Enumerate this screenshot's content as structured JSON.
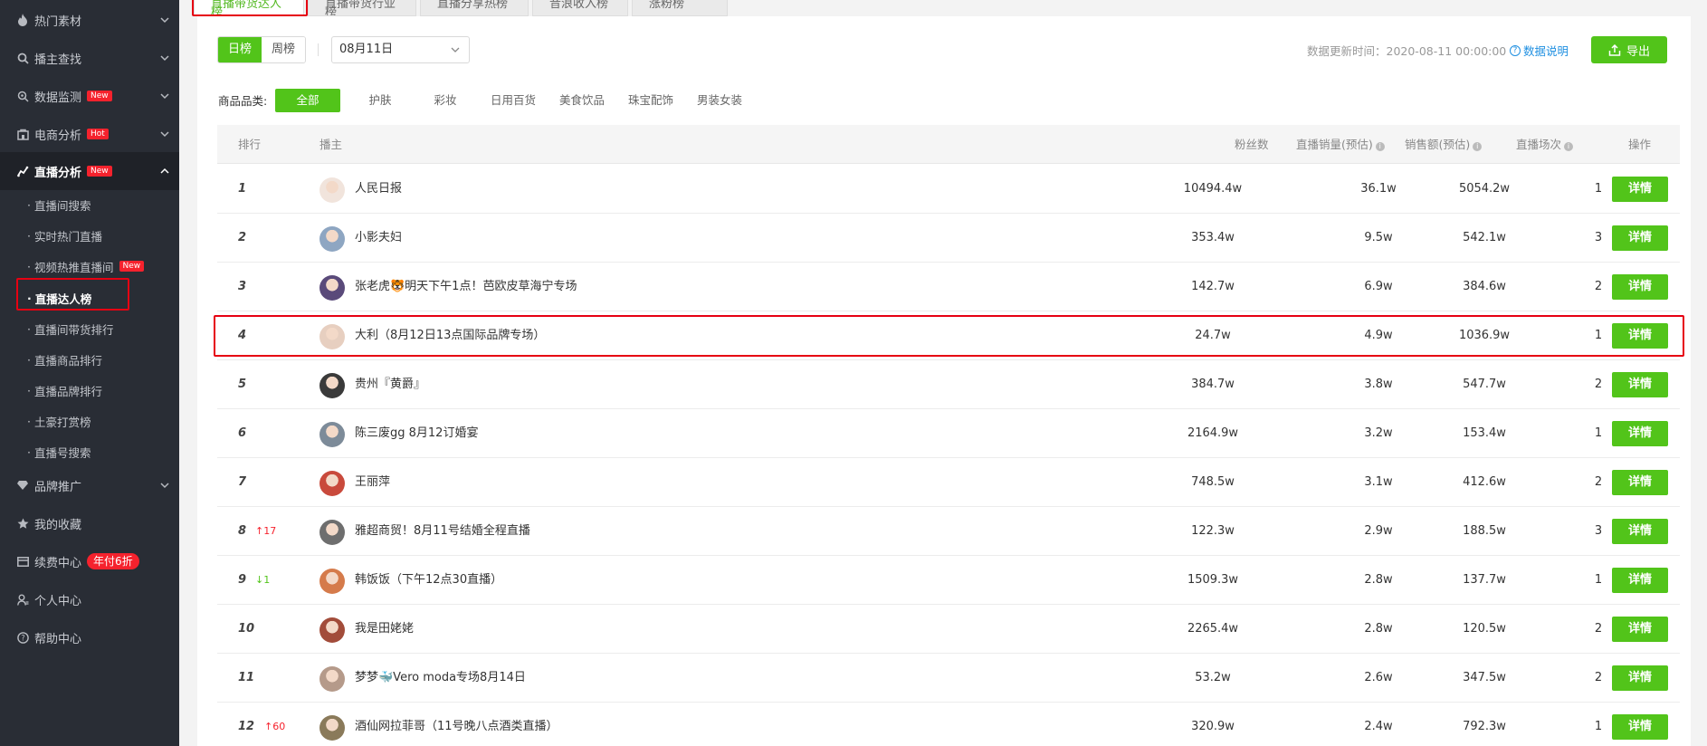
{
  "sidebar": {
    "items": [
      {
        "label": "热门素材",
        "icon": "fire-icon"
      },
      {
        "label": "播主查找",
        "icon": "search-icon"
      },
      {
        "label": "数据监测",
        "icon": "monitor-icon",
        "badge": "New"
      },
      {
        "label": "电商分析",
        "icon": "shop-icon",
        "badge": "Hot"
      },
      {
        "label": "直播分析",
        "icon": "live-chart-icon",
        "badge": "New"
      }
    ],
    "sub_items": [
      {
        "label": "直播间搜索"
      },
      {
        "label": "实时热门直播"
      },
      {
        "label": "视频热推直播间",
        "badge": "New"
      },
      {
        "label": "直播达人榜"
      },
      {
        "label": "直播间带货排行"
      },
      {
        "label": "直播商品排行"
      },
      {
        "label": "直播品牌排行"
      },
      {
        "label": "土豪打赏榜"
      },
      {
        "label": "直播号搜索"
      }
    ],
    "bottom_items": [
      {
        "label": "品牌推广",
        "icon": "diamond-icon"
      },
      {
        "label": "我的收藏",
        "icon": "star-icon"
      },
      {
        "label": "续费中心",
        "icon": "card-icon",
        "badge": "年付6折"
      },
      {
        "label": "个人中心",
        "icon": "user-icon"
      },
      {
        "label": "帮助中心",
        "icon": "help-icon"
      }
    ]
  },
  "tabs": [
    "直播带货达人榜",
    "直播带货行业榜",
    "直播分享热榜",
    "音浪收入榜",
    "涨粉榜"
  ],
  "toolbar": {
    "period_tabs": [
      "日榜",
      "周榜"
    ],
    "date": "08月11日",
    "update_label": "数据更新时间：2020-08-11 00:00:00",
    "help_label": "数据说明",
    "export_label": "导出"
  },
  "categories": {
    "label": "商品品类:",
    "items": [
      "全部",
      "护肤",
      "彩妆",
      "日用百货",
      "美食饮品",
      "珠宝配饰",
      "男装女装"
    ]
  },
  "table": {
    "headers": {
      "rank": "排行",
      "anchor": "播主",
      "fans": "粉丝数",
      "sales": "直播销量(预估)",
      "gmv": "销售额(预估)",
      "sessions": "直播场次",
      "action": "操作"
    },
    "detail_label": "详情",
    "rows": [
      {
        "rank": "1",
        "delta": "",
        "name": "人民日报",
        "fans": "10494.4w",
        "sales": "36.1w",
        "gmv": "5054.2w",
        "sessions": "1"
      },
      {
        "rank": "2",
        "delta": "",
        "name": "小影夫妇",
        "fans": "353.4w",
        "sales": "9.5w",
        "gmv": "542.1w",
        "sessions": "3"
      },
      {
        "rank": "3",
        "delta": "",
        "name": "张老虎🐯明天下午1点！芭欧皮草海宁专场",
        "fans": "142.7w",
        "sales": "6.9w",
        "gmv": "384.6w",
        "sessions": "2"
      },
      {
        "rank": "4",
        "delta": "",
        "name": "大利（8月12日13点国际品牌专场）",
        "fans": "24.7w",
        "sales": "4.9w",
        "gmv": "1036.9w",
        "sessions": "1"
      },
      {
        "rank": "5",
        "delta": "",
        "name": "贵州『黄爵』",
        "fans": "384.7w",
        "sales": "3.8w",
        "gmv": "547.7w",
        "sessions": "2"
      },
      {
        "rank": "6",
        "delta": "",
        "name": "陈三废gg 8月12订婚宴",
        "fans": "2164.9w",
        "sales": "3.2w",
        "gmv": "153.4w",
        "sessions": "1"
      },
      {
        "rank": "7",
        "delta": "",
        "name": "王丽萍",
        "fans": "748.5w",
        "sales": "3.1w",
        "gmv": "412.6w",
        "sessions": "2"
      },
      {
        "rank": "8",
        "delta": "↑17",
        "dir": "up",
        "name": "雅超商贸！8月11号结婚全程直播",
        "fans": "122.3w",
        "sales": "2.9w",
        "gmv": "188.5w",
        "sessions": "3"
      },
      {
        "rank": "9",
        "delta": "↓1",
        "dir": "down",
        "name": "韩饭饭（下午12点30直播）",
        "fans": "1509.3w",
        "sales": "2.8w",
        "gmv": "137.7w",
        "sessions": "1"
      },
      {
        "rank": "10",
        "delta": "",
        "name": "我是田姥姥",
        "fans": "2265.4w",
        "sales": "2.8w",
        "gmv": "120.5w",
        "sessions": "2"
      },
      {
        "rank": "11",
        "delta": "",
        "name": "梦梦🐳Vero moda专场8月14日",
        "fans": "53.2w",
        "sales": "2.6w",
        "gmv": "347.5w",
        "sessions": "2"
      },
      {
        "rank": "12",
        "delta": "↑60",
        "dir": "up",
        "name": "酒仙网拉菲哥（11号晚八点酒类直播）",
        "fans": "320.9w",
        "sales": "2.4w",
        "gmv": "792.3w",
        "sessions": "1"
      }
    ]
  },
  "colors": {
    "accent": "#52c41a",
    "sidebar_bg": "#292d35",
    "highlight": "#e60012",
    "badge": "#f5222d"
  }
}
